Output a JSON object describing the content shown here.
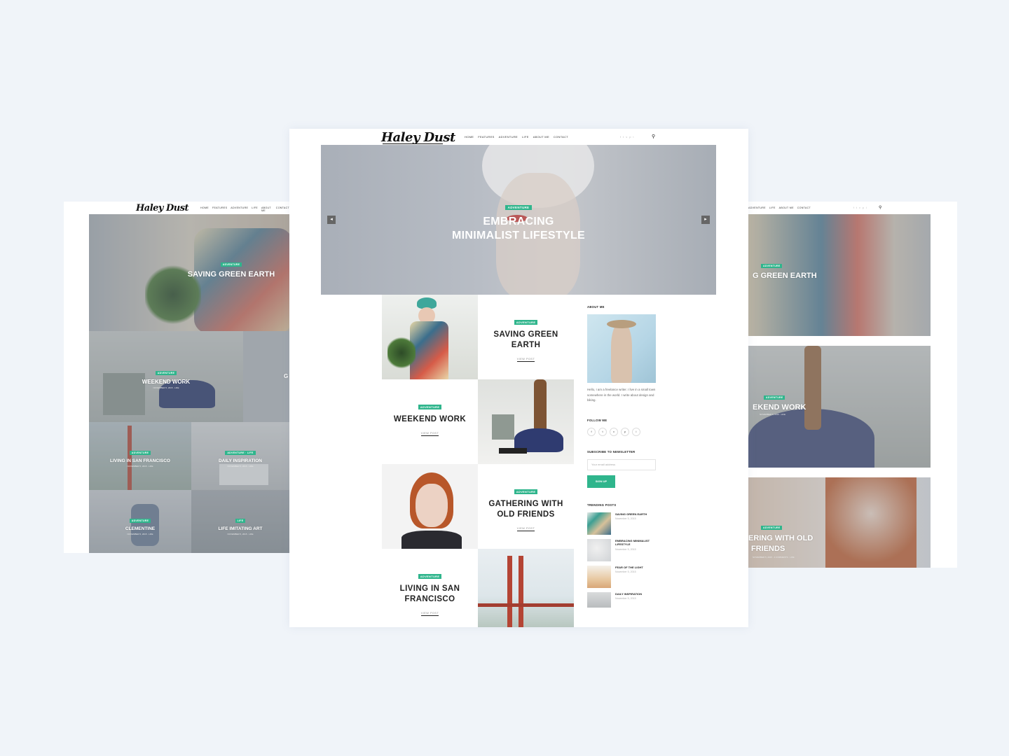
{
  "brand": {
    "logo": "Haley Dust",
    "accent": "#2fb58c",
    "background": "#f0f4f9"
  },
  "nav": {
    "items": [
      "HOME",
      "FEATURES",
      "ADVENTURE",
      "LIFE",
      "ABOUT ME",
      "CONTACT"
    ],
    "right_items": [
      "ADVENTURE",
      "LIFE",
      "ABOUT ME",
      "CONTACT"
    ],
    "social_icons": [
      "f",
      "t",
      "v",
      "p",
      "i"
    ],
    "search_icon": "search-icon"
  },
  "left_mock": {
    "tiles": [
      {
        "badge": "ADVENTURE",
        "title": "SAVING GREEN EARTH",
        "meta": ""
      },
      {
        "badge": "ADVENTURE",
        "title": "WEEKEND WORK",
        "meta": "NOVEMBER 5, 2015 · LIFE"
      },
      {
        "badge": "",
        "title": "G",
        "meta": ""
      },
      {
        "badge": "ADVENTURE",
        "title": "LIVING IN SAN FRANCISCO",
        "meta": "NOVEMBER 5, 2015 · LIFE"
      },
      {
        "badge": "ADVENTURE · LIFE",
        "title": "DAILY INSPIRATION",
        "meta": "NOVEMBER 5, 2015 · LIFE"
      },
      {
        "badge": "ADVENTURE",
        "title": "CLEMENTINE",
        "meta": "NOVEMBER 5, 2015 · LIFE"
      },
      {
        "badge": "LIFE",
        "title": "LIFE IMITATING ART",
        "meta": "NOVEMBER 5, 2015 · LIFE"
      }
    ]
  },
  "center_mock": {
    "hero": {
      "badge": "ADVENTURE",
      "title_line1": "EMBRACING",
      "title_line2": "MINIMALIST LIFESTYLE",
      "prev": "◂",
      "next": "▸"
    },
    "posts": [
      {
        "badge": "ADVENTURE",
        "title": "SAVING GREEN EARTH",
        "view": "VIEW POST"
      },
      {
        "badge": "ADVENTURE",
        "title": "WEEKEND WORK",
        "view": "VIEW POST"
      },
      {
        "badge": "ADVENTURE",
        "title": "GATHERING WITH OLD FRIENDS",
        "view": "VIEW POST"
      },
      {
        "badge": "ADVENTURE",
        "title": "LIVING IN SAN FRANCISCO",
        "view": "VIEW POST"
      }
    ],
    "sidebar": {
      "about_heading": "ABOUT ME",
      "about_text": "Hello, I am a freelance writer. I live in a small town somewhere in the world. I write about design and biking.",
      "follow_heading": "FOLLOW ME",
      "follow_icons": [
        "f",
        "t",
        "v",
        "p",
        "i"
      ],
      "newsletter_heading": "SUBSCRIBE TO NEWSLETTER",
      "email_placeholder": "Your email address",
      "signup_label": "SIGN UP",
      "trending_heading": "TRENDING POSTS",
      "trending": [
        {
          "title": "SAVING GREEN EARTH",
          "date": "November 5, 2015"
        },
        {
          "title": "EMBRACING MINIMALIST LIFESTYLE",
          "date": "November 5, 2015"
        },
        {
          "title": "FEAR OF THE LIGHT",
          "date": "November 5, 2015"
        },
        {
          "title": "DAILY INSPIRATION",
          "date": "November 5, 2015"
        }
      ]
    }
  },
  "right_mock": {
    "tiles": [
      {
        "badge": "ADVENTURE",
        "title": "G GREEN EARTH",
        "meta": ""
      },
      {
        "badge": "ADVENTURE",
        "title": "EKEND WORK",
        "meta": "NOVEMBER 5, 2015 · LIFE"
      },
      {
        "badge": "ADVENTURE",
        "title_line1": "ERING WITH OLD",
        "title_line2": "FRIENDS",
        "meta": "NOVEMBER 5, 2015 · 4 COMMENTS · LIFE"
      }
    ]
  }
}
